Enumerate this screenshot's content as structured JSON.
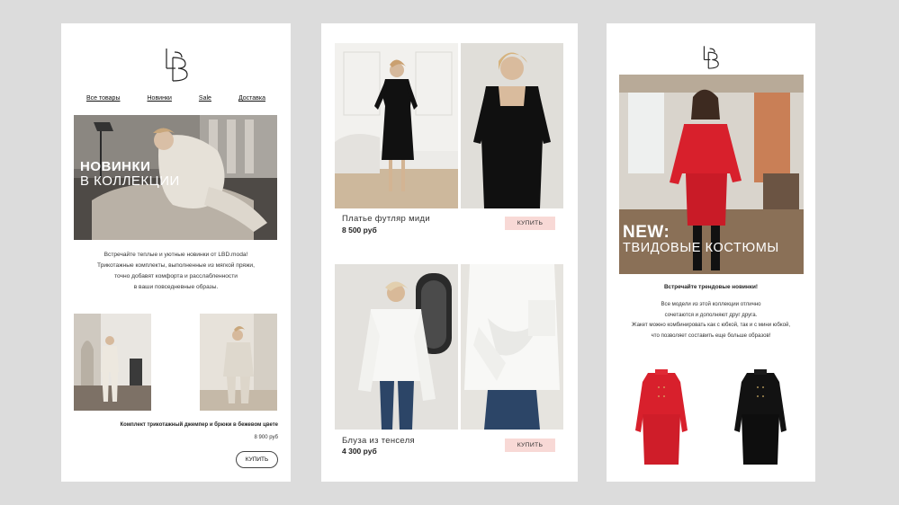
{
  "brand": {
    "logo_text": "LBD"
  },
  "card1": {
    "nav": [
      "Все товары",
      "Новинки",
      "Sale",
      "Доставка"
    ],
    "hero": {
      "line1": "НОВИНКИ",
      "line2": "В КОЛЛЕКЦИИ"
    },
    "intro": [
      "Встречайте теплые и уютные новинки от LBD.moda!",
      "Трикотажные комплекты, выполненные из мягкой пряжи,",
      "точно добавят комфорта и расслабленности",
      "в ваши повседневные образы."
    ],
    "product": {
      "name": "Комплект трикотажный джемпер и брюки в бежевом цвете",
      "price": "8 900 руб",
      "button": "КУПИТЬ"
    }
  },
  "card2": {
    "items": [
      {
        "name": "Платье футляр миди",
        "price": "8 500 руб",
        "button": "КУПИТЬ"
      },
      {
        "name": "Блуза из тенселя",
        "price": "4 300 руб",
        "button": "КУПИТЬ"
      }
    ]
  },
  "card3": {
    "hero": {
      "line1": "NEW:",
      "line2": "ТВИДОВЫЕ КОСТЮМЫ"
    },
    "headline": "Встречайте трендовые новинки!",
    "body": [
      "Все модели из этой коллекции отлично",
      "сочетаются и дополняют друг друга.",
      "Жакет можно комбинировать как с юбкой, так и с мини юбкой,",
      "что позволяет составить еще больше образов!"
    ]
  },
  "colors": {
    "page_bg": "#dcdcdc",
    "button_pink": "#f8d9d6",
    "suit_red": "#d8202c",
    "suit_black": "#121212"
  }
}
